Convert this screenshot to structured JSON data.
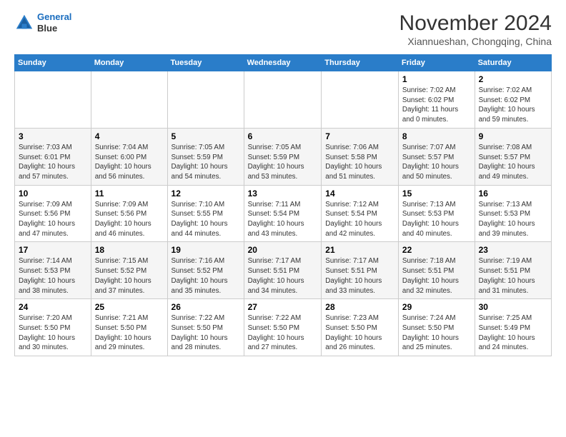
{
  "header": {
    "logo_line1": "General",
    "logo_line2": "Blue",
    "month_title": "November 2024",
    "location": "Xiannueshan, Chongqing, China"
  },
  "weekdays": [
    "Sunday",
    "Monday",
    "Tuesday",
    "Wednesday",
    "Thursday",
    "Friday",
    "Saturday"
  ],
  "weeks": [
    [
      {
        "day": "",
        "info": ""
      },
      {
        "day": "",
        "info": ""
      },
      {
        "day": "",
        "info": ""
      },
      {
        "day": "",
        "info": ""
      },
      {
        "day": "",
        "info": ""
      },
      {
        "day": "1",
        "info": "Sunrise: 7:02 AM\nSunset: 6:02 PM\nDaylight: 11 hours\nand 0 minutes."
      },
      {
        "day": "2",
        "info": "Sunrise: 7:02 AM\nSunset: 6:02 PM\nDaylight: 10 hours\nand 59 minutes."
      }
    ],
    [
      {
        "day": "3",
        "info": "Sunrise: 7:03 AM\nSunset: 6:01 PM\nDaylight: 10 hours\nand 57 minutes."
      },
      {
        "day": "4",
        "info": "Sunrise: 7:04 AM\nSunset: 6:00 PM\nDaylight: 10 hours\nand 56 minutes."
      },
      {
        "day": "5",
        "info": "Sunrise: 7:05 AM\nSunset: 5:59 PM\nDaylight: 10 hours\nand 54 minutes."
      },
      {
        "day": "6",
        "info": "Sunrise: 7:05 AM\nSunset: 5:59 PM\nDaylight: 10 hours\nand 53 minutes."
      },
      {
        "day": "7",
        "info": "Sunrise: 7:06 AM\nSunset: 5:58 PM\nDaylight: 10 hours\nand 51 minutes."
      },
      {
        "day": "8",
        "info": "Sunrise: 7:07 AM\nSunset: 5:57 PM\nDaylight: 10 hours\nand 50 minutes."
      },
      {
        "day": "9",
        "info": "Sunrise: 7:08 AM\nSunset: 5:57 PM\nDaylight: 10 hours\nand 49 minutes."
      }
    ],
    [
      {
        "day": "10",
        "info": "Sunrise: 7:09 AM\nSunset: 5:56 PM\nDaylight: 10 hours\nand 47 minutes."
      },
      {
        "day": "11",
        "info": "Sunrise: 7:09 AM\nSunset: 5:56 PM\nDaylight: 10 hours\nand 46 minutes."
      },
      {
        "day": "12",
        "info": "Sunrise: 7:10 AM\nSunset: 5:55 PM\nDaylight: 10 hours\nand 44 minutes."
      },
      {
        "day": "13",
        "info": "Sunrise: 7:11 AM\nSunset: 5:54 PM\nDaylight: 10 hours\nand 43 minutes."
      },
      {
        "day": "14",
        "info": "Sunrise: 7:12 AM\nSunset: 5:54 PM\nDaylight: 10 hours\nand 42 minutes."
      },
      {
        "day": "15",
        "info": "Sunrise: 7:13 AM\nSunset: 5:53 PM\nDaylight: 10 hours\nand 40 minutes."
      },
      {
        "day": "16",
        "info": "Sunrise: 7:13 AM\nSunset: 5:53 PM\nDaylight: 10 hours\nand 39 minutes."
      }
    ],
    [
      {
        "day": "17",
        "info": "Sunrise: 7:14 AM\nSunset: 5:53 PM\nDaylight: 10 hours\nand 38 minutes."
      },
      {
        "day": "18",
        "info": "Sunrise: 7:15 AM\nSunset: 5:52 PM\nDaylight: 10 hours\nand 37 minutes."
      },
      {
        "day": "19",
        "info": "Sunrise: 7:16 AM\nSunset: 5:52 PM\nDaylight: 10 hours\nand 35 minutes."
      },
      {
        "day": "20",
        "info": "Sunrise: 7:17 AM\nSunset: 5:51 PM\nDaylight: 10 hours\nand 34 minutes."
      },
      {
        "day": "21",
        "info": "Sunrise: 7:17 AM\nSunset: 5:51 PM\nDaylight: 10 hours\nand 33 minutes."
      },
      {
        "day": "22",
        "info": "Sunrise: 7:18 AM\nSunset: 5:51 PM\nDaylight: 10 hours\nand 32 minutes."
      },
      {
        "day": "23",
        "info": "Sunrise: 7:19 AM\nSunset: 5:51 PM\nDaylight: 10 hours\nand 31 minutes."
      }
    ],
    [
      {
        "day": "24",
        "info": "Sunrise: 7:20 AM\nSunset: 5:50 PM\nDaylight: 10 hours\nand 30 minutes."
      },
      {
        "day": "25",
        "info": "Sunrise: 7:21 AM\nSunset: 5:50 PM\nDaylight: 10 hours\nand 29 minutes."
      },
      {
        "day": "26",
        "info": "Sunrise: 7:22 AM\nSunset: 5:50 PM\nDaylight: 10 hours\nand 28 minutes."
      },
      {
        "day": "27",
        "info": "Sunrise: 7:22 AM\nSunset: 5:50 PM\nDaylight: 10 hours\nand 27 minutes."
      },
      {
        "day": "28",
        "info": "Sunrise: 7:23 AM\nSunset: 5:50 PM\nDaylight: 10 hours\nand 26 minutes."
      },
      {
        "day": "29",
        "info": "Sunrise: 7:24 AM\nSunset: 5:50 PM\nDaylight: 10 hours\nand 25 minutes."
      },
      {
        "day": "30",
        "info": "Sunrise: 7:25 AM\nSunset: 5:49 PM\nDaylight: 10 hours\nand 24 minutes."
      }
    ]
  ]
}
